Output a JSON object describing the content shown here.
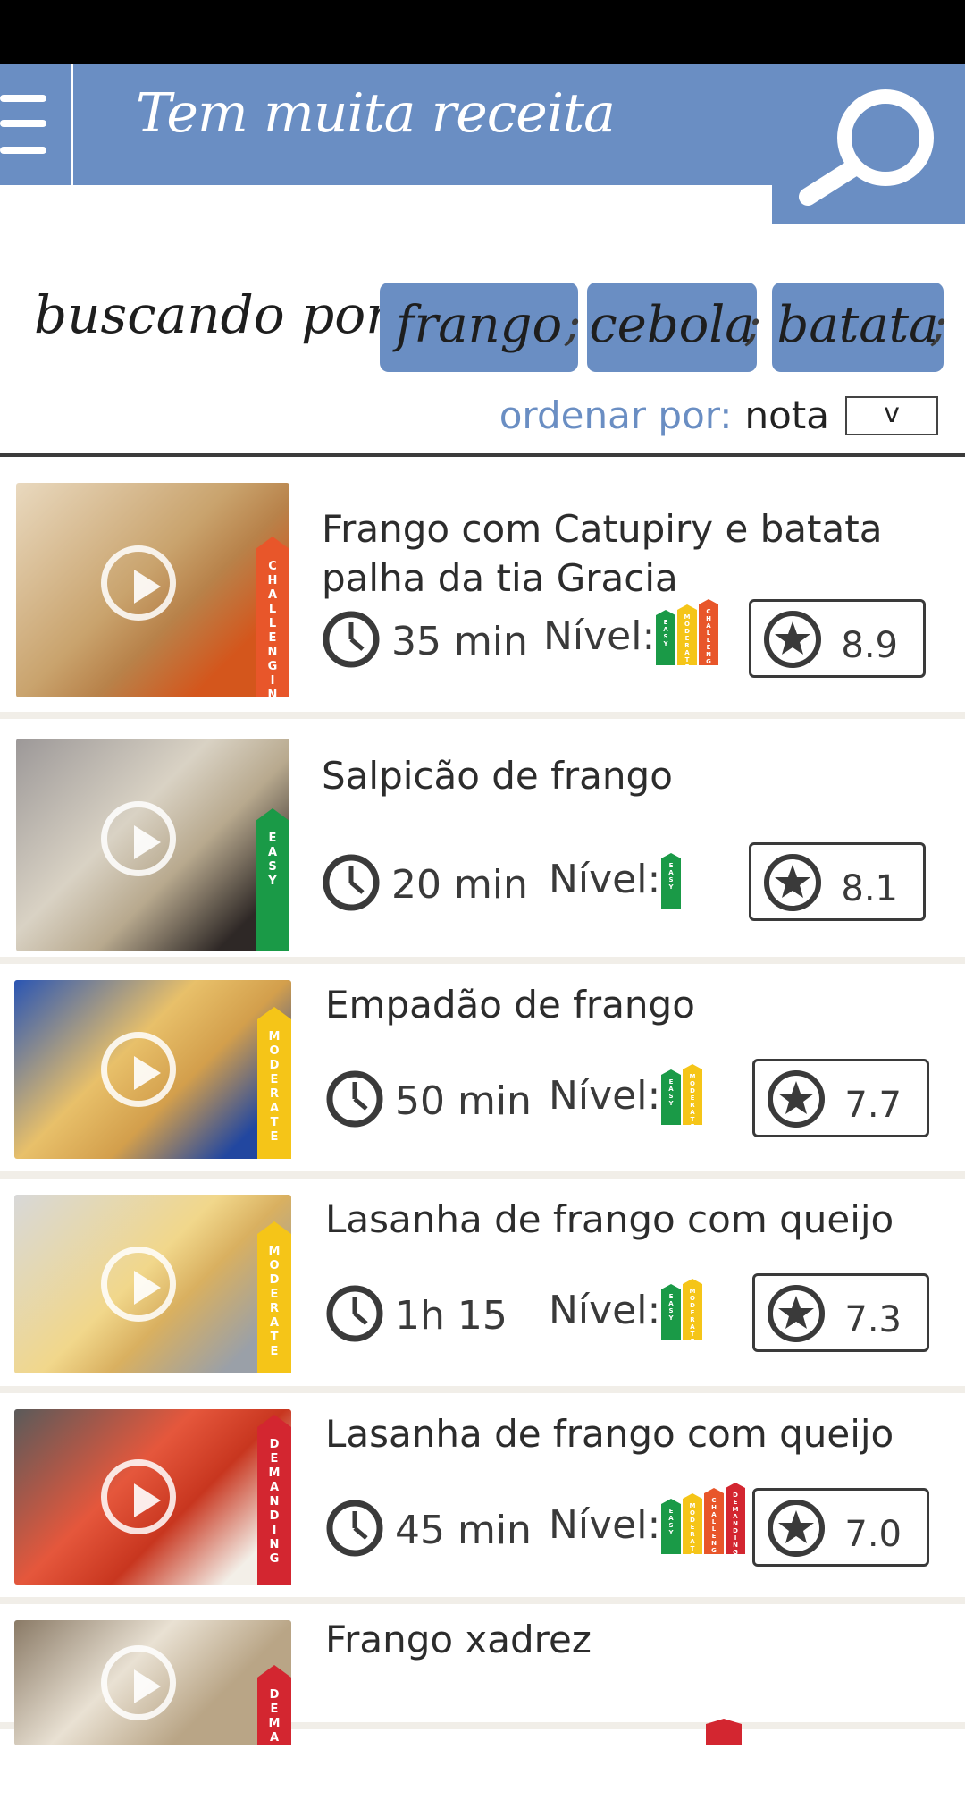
{
  "header": {
    "app_title": "Tem muita receita",
    "menu_icon": "hamburger-menu-icon",
    "search_icon": "magnifier-icon",
    "brand_color": "#6a8ec3"
  },
  "search": {
    "label": "buscando por:",
    "terms": [
      "frango",
      "cebola",
      "batata"
    ],
    "separator": ";"
  },
  "sort": {
    "label": "ordenar por:",
    "value": "nota",
    "dropdown_glyph": "v"
  },
  "level_colors": {
    "easy": "#1a9a47",
    "moderate": "#f5c518",
    "challenging": "#e8562a",
    "demanding": "#d32630"
  },
  "recipes": [
    {
      "title": "Frango com Catupiry e batata palha da tia Gracia",
      "time": "35 min",
      "level_label": "Nível:",
      "level": "CHALLENGING",
      "level_bars": [
        "EASY",
        "MODERATE",
        "CHALLENGING"
      ],
      "rating": "8.9"
    },
    {
      "title": "Salpicão de frango",
      "time": "20 min",
      "level_label": "Nível:",
      "level": "EASY",
      "level_bars": [
        "EASY"
      ],
      "rating": "8.1"
    },
    {
      "title": "Empadão de frango",
      "time": "50 min",
      "level_label": "Nível:",
      "level": "MODERATE",
      "level_bars": [
        "EASY",
        "MODERATE"
      ],
      "rating": "7.7"
    },
    {
      "title": "Lasanha de frango com queijo",
      "time": "1h 15",
      "level_label": "Nível:",
      "level": "MODERATE",
      "level_bars": [
        "EASY",
        "MODERATE"
      ],
      "rating": "7.3"
    },
    {
      "title": "Lasanha de frango com queijo",
      "time": "45 min",
      "level_label": "Nível:",
      "level": "DEMANDING",
      "level_bars": [
        "EASY",
        "MODERATE",
        "CHALLENGING",
        "DEMANDING"
      ],
      "rating": "7.0"
    },
    {
      "title": "Frango xadrez",
      "time": "",
      "level_label": "",
      "level": "DEMANDING",
      "level_bars": [],
      "rating": ""
    }
  ]
}
